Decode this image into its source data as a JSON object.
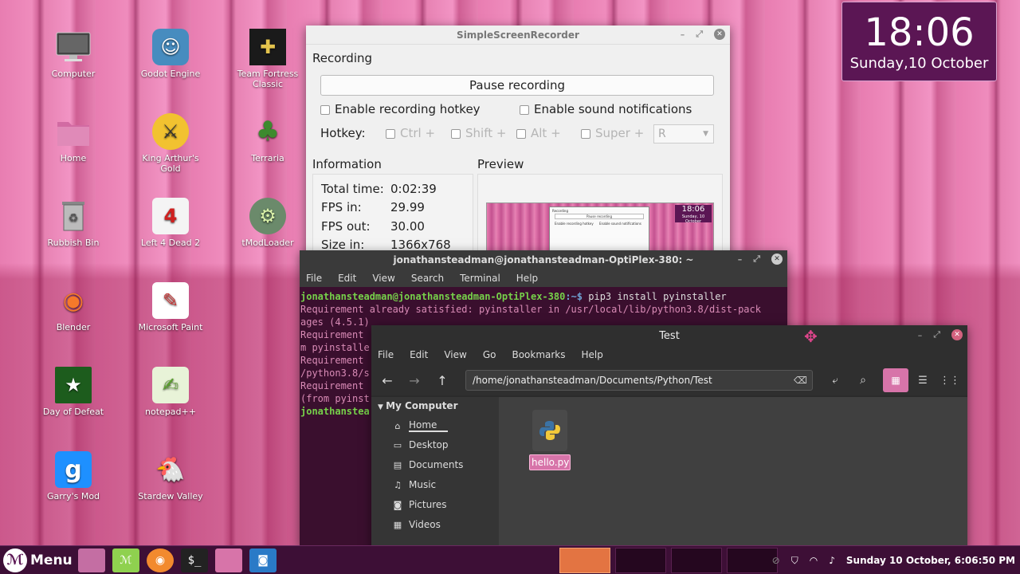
{
  "desktop": {
    "icons": [
      {
        "label": "Computer",
        "icon": "computer-icon"
      },
      {
        "label": "Godot Engine",
        "icon": "godot-icon"
      },
      {
        "label": "Team Fortress Classic",
        "icon": "tfc-icon"
      },
      {
        "label": "Home",
        "icon": "home-folder-icon"
      },
      {
        "label": "King Arthur's Gold",
        "icon": "kag-icon"
      },
      {
        "label": "Terraria",
        "icon": "terraria-icon"
      },
      {
        "label": "Rubbish Bin",
        "icon": "trash-icon"
      },
      {
        "label": "Left 4 Dead 2",
        "icon": "l4d2-icon"
      },
      {
        "label": "tModLoader",
        "icon": "tmodloader-icon"
      },
      {
        "label": "Blender",
        "icon": "blender-icon"
      },
      {
        "label": "Microsoft Paint",
        "icon": "paint-icon"
      },
      {
        "label": "Day of Defeat",
        "icon": "dod-icon"
      },
      {
        "label": "notepad++",
        "icon": "notepad-icon"
      },
      {
        "label": "Garry's Mod",
        "icon": "gmod-icon"
      },
      {
        "label": "Stardew Valley",
        "icon": "stardew-icon"
      }
    ]
  },
  "clock_widget": {
    "time": "18:06",
    "date": "Sunday,10 October"
  },
  "ssr": {
    "title": "SimpleScreenRecorder",
    "recording_heading": "Recording",
    "pause_button": "Pause recording",
    "enable_hotkey": "Enable recording hotkey",
    "enable_sound": "Enable sound notifications",
    "hotkey_label": "Hotkey:",
    "ctrl": "Ctrl +",
    "shift": "Shift +",
    "alt": "Alt +",
    "super": "Super +",
    "key_value": "R",
    "information_heading": "Information",
    "preview_heading": "Preview",
    "info": [
      {
        "label": "Total time:",
        "value": "0:02:39"
      },
      {
        "label": "FPS in:",
        "value": "29.99"
      },
      {
        "label": "FPS out:",
        "value": "30.00"
      },
      {
        "label": "Size in:",
        "value": "1366x768"
      }
    ],
    "preview_clock": {
      "time": "18:06",
      "date": "Sunday, 10 October"
    },
    "preview_window": {
      "title": "Recording",
      "button": "Pause recording",
      "hotkey": "Enable recording hotkey",
      "sound": "Enable sound notifications"
    }
  },
  "terminal": {
    "title": "jonathansteadman@jonathansteadman-OptiPlex-380: ~",
    "menu": [
      "File",
      "Edit",
      "View",
      "Search",
      "Terminal",
      "Help"
    ],
    "prompt_user": "jonathansteadman@jonathansteadman-OptiPlex-380",
    "prompt_path": ":~$",
    "command": " pip3 install pyinstaller",
    "lines": [
      "Requirement already satisfied: pyinstaller in /usr/local/lib/python3.8/dist-pack",
      "ages (4.5.1)",
      "Requirement",
      "m pyinstalle",
      "Requirement",
      "/python3.8/s",
      "Requirement",
      "(from pyinst"
    ],
    "last_prompt": "jonathanstea"
  },
  "filemanager": {
    "title": "Test",
    "menu": [
      "File",
      "Edit",
      "View",
      "Go",
      "Bookmarks",
      "Help"
    ],
    "path": "/home/jonathansteadman/Documents/Python/Test",
    "sidebar_heading": "My Computer",
    "sidebar_items": [
      {
        "label": "Home",
        "icon": "home-icon"
      },
      {
        "label": "Desktop",
        "icon": "desktop-icon"
      },
      {
        "label": "Documents",
        "icon": "documents-icon"
      },
      {
        "label": "Music",
        "icon": "music-icon"
      },
      {
        "label": "Pictures",
        "icon": "pictures-icon"
      },
      {
        "label": "Videos",
        "icon": "videos-icon"
      }
    ],
    "files": [
      {
        "name": "hello.py",
        "icon": "python-file-icon"
      }
    ]
  },
  "taskbar": {
    "menu_label": "Menu",
    "datetime": "Sunday 10 October, 6:06:50 PM"
  },
  "colors": {
    "accent": "#d774a9",
    "panel": "#3d0f36",
    "clock_bg": "#5b1654"
  }
}
